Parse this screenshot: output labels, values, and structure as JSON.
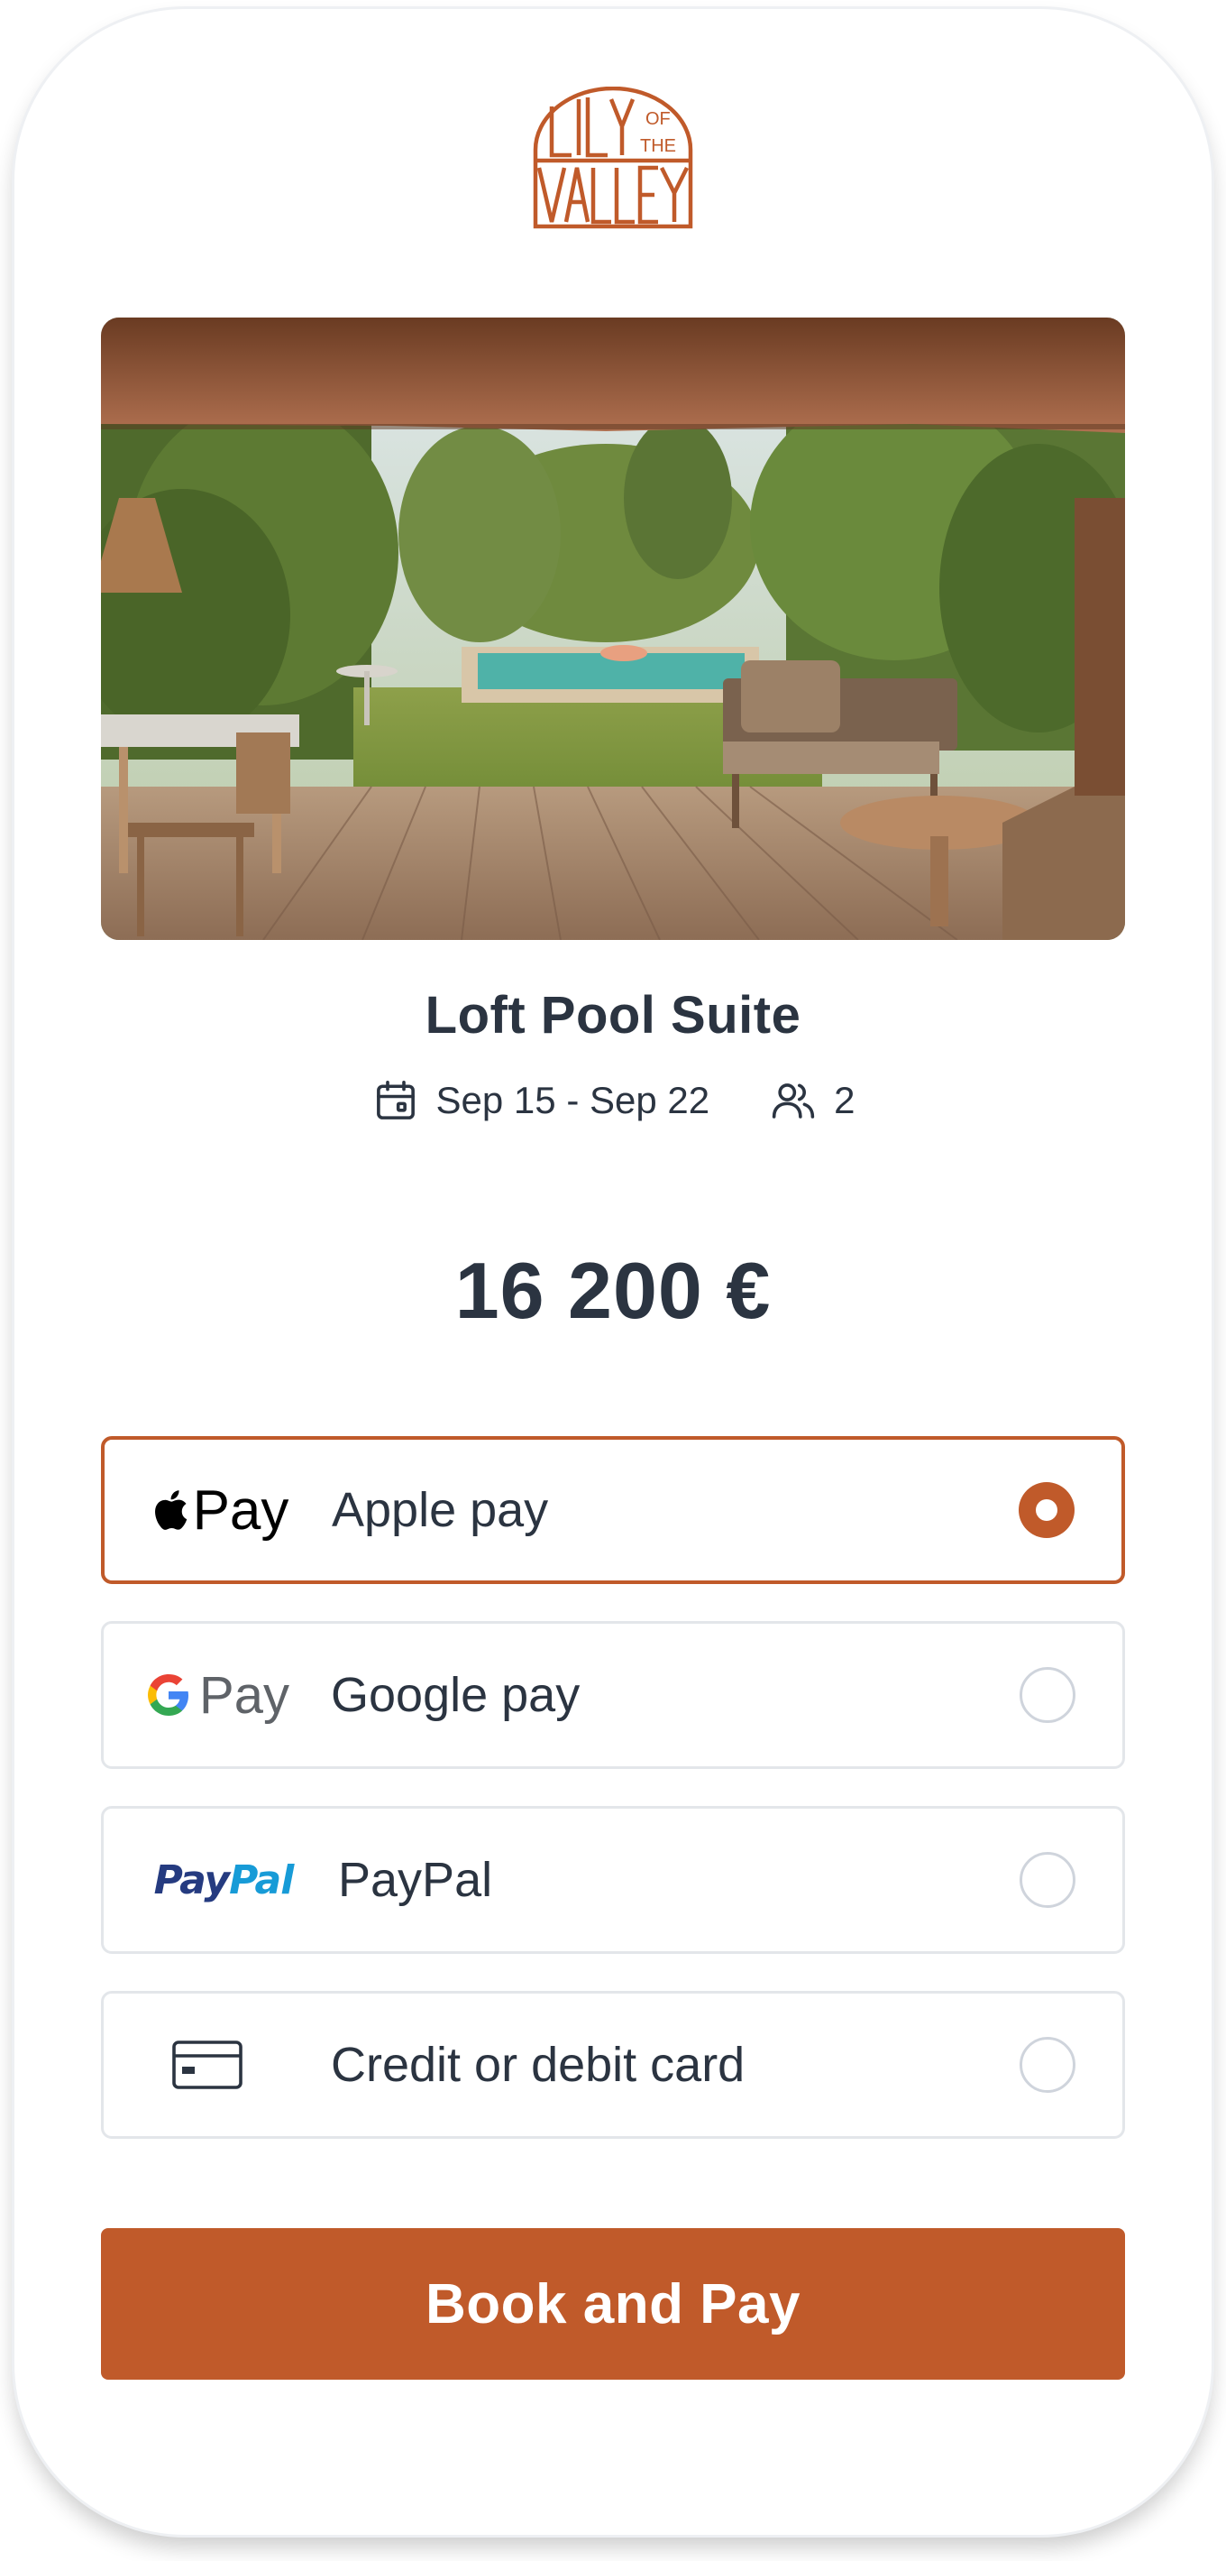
{
  "brand": {
    "logo_text": "LILY OF THE VALLEY",
    "accent_color": "#c05a2a"
  },
  "hero": {
    "image_desc": "covered-terrace-with-pool-photo"
  },
  "room": {
    "title": "Loft Pool Suite",
    "dates": "Sep 15 - Sep 22",
    "guests": "2",
    "date_icon": "calendar-icon",
    "guests_icon": "users-icon"
  },
  "price": {
    "amount": "16 200 €"
  },
  "payment": {
    "selected": "apple_pay",
    "options": [
      {
        "id": "apple_pay",
        "logo": "Pay",
        "label": "Apple pay",
        "icon": "apple-pay-icon"
      },
      {
        "id": "google_pay",
        "logo": "Pay",
        "label": "Google pay",
        "icon": "google-pay-icon"
      },
      {
        "id": "paypal",
        "logo_part1": "Pay",
        "logo_part2": "Pal",
        "label": "PayPal",
        "icon": "paypal-icon"
      },
      {
        "id": "card",
        "label": "Credit or debit card",
        "icon": "credit-card-icon"
      }
    ]
  },
  "actions": {
    "book_label": "Book and Pay"
  }
}
